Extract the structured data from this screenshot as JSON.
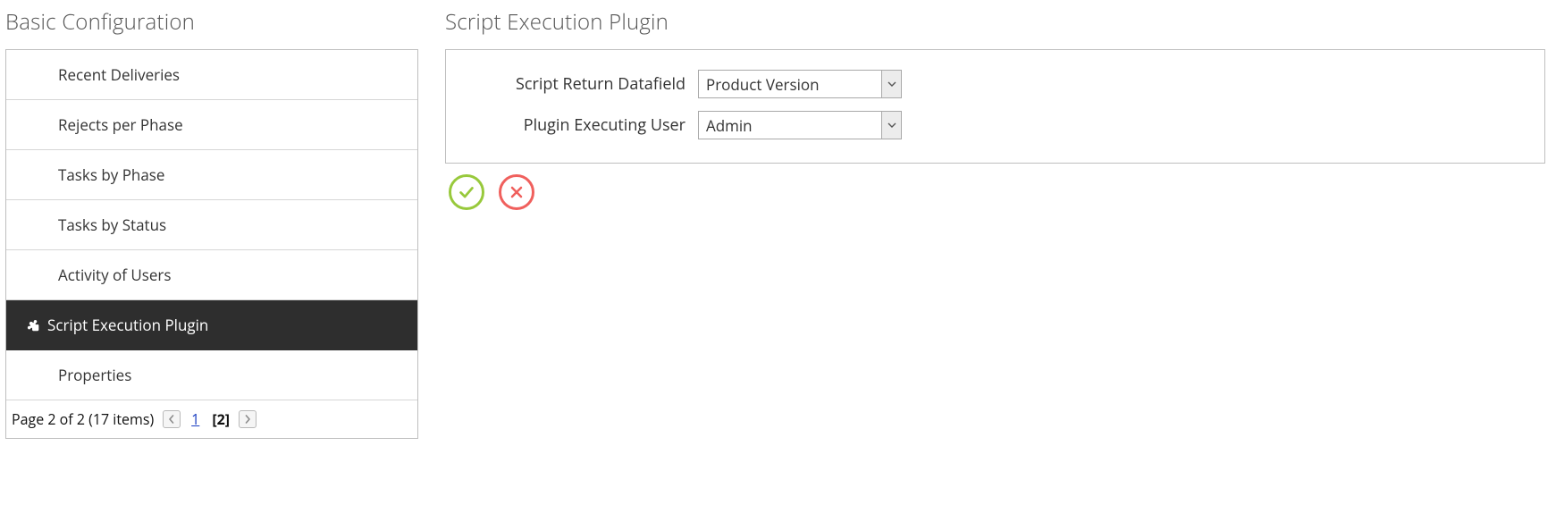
{
  "left": {
    "title": "Basic Configuration",
    "items": [
      {
        "label": "Recent Deliveries",
        "selected": false
      },
      {
        "label": "Rejects per Phase",
        "selected": false
      },
      {
        "label": "Tasks by Phase",
        "selected": false
      },
      {
        "label": "Tasks by Status",
        "selected": false
      },
      {
        "label": "Activity of Users",
        "selected": false
      },
      {
        "label": "Script Execution Plugin",
        "selected": true
      },
      {
        "label": "Properties",
        "selected": false
      }
    ],
    "pager": {
      "summary": "Page 2 of 2 (17 items)",
      "page_link": "1",
      "current_page": "[2]"
    }
  },
  "right": {
    "title": "Script Execution Plugin",
    "fields": {
      "script_return_label": "Script Return Datafield",
      "script_return_value": "Product Version",
      "exec_user_label": "Plugin Executing User",
      "exec_user_value": "Admin"
    }
  }
}
